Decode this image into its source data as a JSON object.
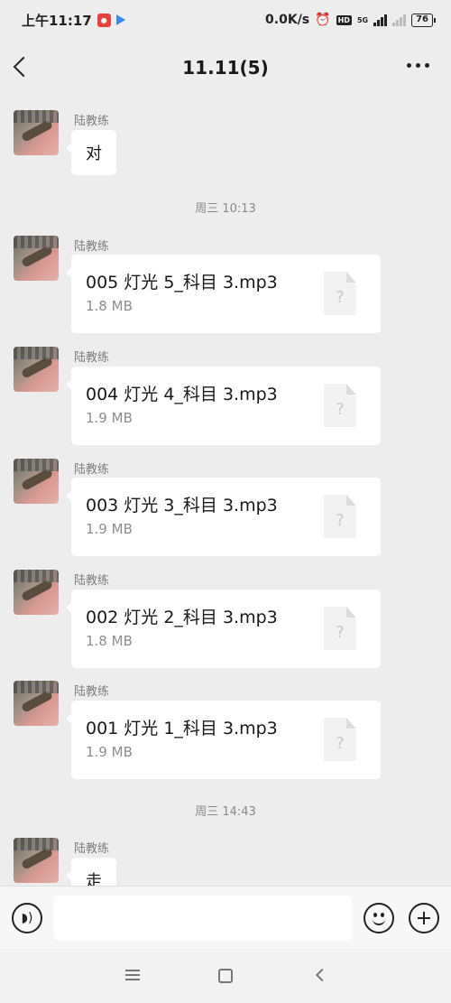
{
  "status_bar": {
    "time": "上午11:17",
    "network_speed": "0.0K/s",
    "hd": "HD",
    "network_type": "5G",
    "battery": "76"
  },
  "header": {
    "title": "11.11(5)"
  },
  "messages": [
    {
      "sender": "陆教练",
      "text": "对"
    },
    {
      "timestamp": "周三 10:13"
    },
    {
      "sender": "陆教练",
      "file_name": "005 灯光 5_科目 3.mp3",
      "file_size": "1.8 MB"
    },
    {
      "sender": "陆教练",
      "file_name": "004 灯光 4_科目 3.mp3",
      "file_size": "1.9 MB"
    },
    {
      "sender": "陆教练",
      "file_name": "003 灯光 3_科目 3.mp3",
      "file_size": "1.9 MB"
    },
    {
      "sender": "陆教练",
      "file_name": "002 灯光 2_科目 3.mp3",
      "file_size": "1.8 MB"
    },
    {
      "sender": "陆教练",
      "file_name": "001 灯光 1_科目 3.mp3",
      "file_size": "1.9 MB"
    },
    {
      "timestamp": "周三 14:43"
    },
    {
      "sender": "陆教练",
      "text": "走"
    }
  ],
  "file_icon_glyph": "?",
  "input": {
    "placeholder": ""
  },
  "icons": {
    "back": "chevron-left-icon",
    "more": "more-dots-icon",
    "voice": "voice-icon",
    "emoji": "emoji-icon",
    "plus": "plus-icon"
  },
  "colors": {
    "background": "#ededed",
    "bubble": "#ffffff",
    "sent_bubble": "#95ec69",
    "timestamp_text": "#8a8a8a"
  }
}
